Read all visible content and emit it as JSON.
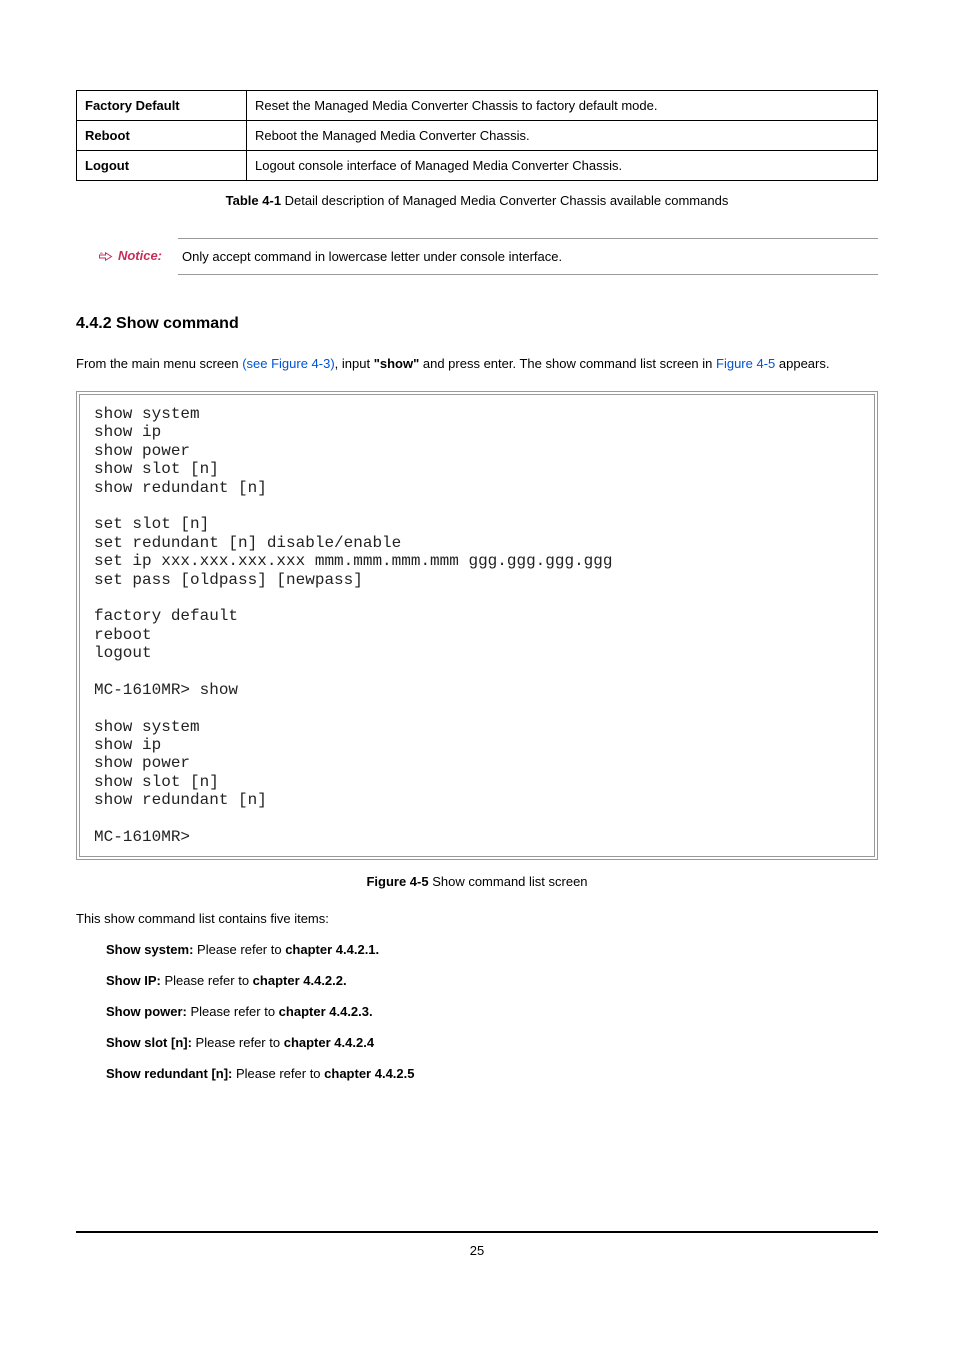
{
  "table": {
    "rows": [
      {
        "cmd": "Factory Default",
        "desc": "Reset the Managed Media Converter Chassis to factory default mode."
      },
      {
        "cmd": "Reboot",
        "desc": "Reboot the Managed Media Converter Chassis."
      },
      {
        "cmd": "Logout",
        "desc": "Logout console interface of Managed Media Converter Chassis."
      }
    ]
  },
  "table_caption_bold": "Table 4-1",
  "table_caption_text": " Detail description of Managed Media Converter Chassis available commands",
  "notice_label": "Notice:",
  "notice_text": "Only accept command in lowercase letter under console interface.",
  "section_heading": "4.4.2 Show command",
  "para": {
    "p1a": "From the main menu screen ",
    "p1_link1": "(see Figure 4-3)",
    "p1b": ", input ",
    "p1_bold": "\"show\"",
    "p1c": " and press enter. The show command list screen in ",
    "p1_link2": "Figure 4-5",
    "p1d": " appears."
  },
  "terminal_text": "show system\nshow ip\nshow power\nshow slot [n]\nshow redundant [n]\n\nset slot [n]\nset redundant [n] disable/enable\nset ip xxx.xxx.xxx.xxx mmm.mmm.mmm.mmm ggg.ggg.ggg.ggg\nset pass [oldpass] [newpass]\n\nfactory default\nreboot\nlogout\n\nMC-1610MR> show\n\nshow system\nshow ip\nshow power\nshow slot [n]\nshow redundant [n]\n\nMC-1610MR>",
  "fig_caption_bold": "Figure 4-5",
  "fig_caption_text": " Show command list screen",
  "list_intro": "This show command list contains five items:",
  "items": [
    {
      "label": "Show system:",
      "middle": "  Please refer to ",
      "ref": "chapter 4.4.2.1."
    },
    {
      "label": "Show IP:",
      "middle": " Please refer to ",
      "ref": "chapter 4.4.2.2."
    },
    {
      "label": "Show power:",
      "middle": " Please refer to ",
      "ref": "chapter 4.4.2.3."
    },
    {
      "label": "Show slot [n]:",
      "middle": " Please refer to ",
      "ref": "chapter 4.4.2.4"
    },
    {
      "label": "Show redundant [n]:",
      "middle": " Please refer to ",
      "ref": "chapter 4.4.2.5"
    }
  ],
  "page_number": "25"
}
